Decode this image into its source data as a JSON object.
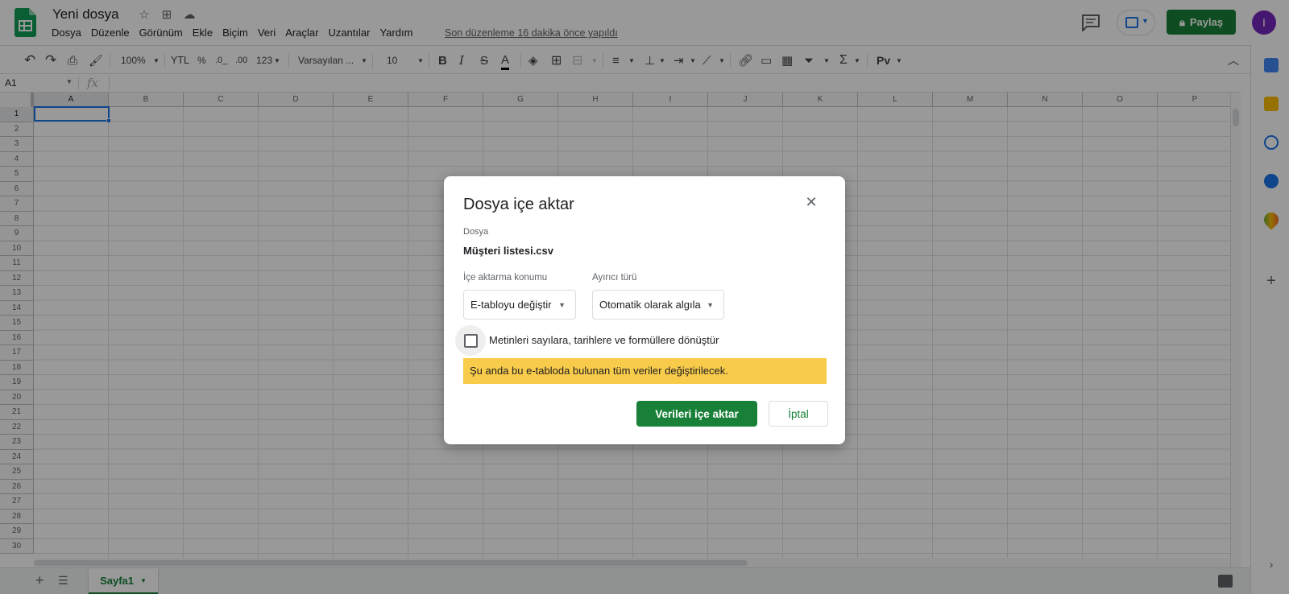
{
  "app": {
    "doc_title": "Yeni dosya",
    "menu": [
      "Dosya",
      "Düzenle",
      "Görünüm",
      "Ekle",
      "Biçim",
      "Veri",
      "Araçlar",
      "Uzantılar",
      "Yardım"
    ],
    "last_edit": "Son düzenleme 16 dakika önce yapıldı",
    "share_label": "Paylaş",
    "avatar_initial": "I"
  },
  "toolbar": {
    "zoom": "100%",
    "currency": "YTL",
    "percent": "%",
    "dec_decrease": ".0_",
    "dec_increase": ".00",
    "number_format": "123",
    "font": "Varsayılan ...",
    "font_size": "10",
    "bold": "B",
    "italic": "I",
    "strike": "S",
    "text_color": "A",
    "sigma": "Σ"
  },
  "formula_bar": {
    "namebox": "A1",
    "fx": "fx"
  },
  "grid": {
    "columns": [
      "A",
      "B",
      "C",
      "D",
      "E",
      "F",
      "G",
      "H",
      "I",
      "J",
      "K",
      "L",
      "M",
      "N",
      "O",
      "P"
    ],
    "rows": [
      "1",
      "2",
      "3",
      "4",
      "5",
      "6",
      "7",
      "8",
      "9",
      "10",
      "11",
      "12",
      "13",
      "14",
      "15",
      "16",
      "17",
      "18",
      "19",
      "20",
      "21",
      "22",
      "23",
      "24",
      "25",
      "26",
      "27",
      "28",
      "29",
      "30"
    ],
    "selected_cell": "A1"
  },
  "sheetbar": {
    "sheet_name": "Sayfa1"
  },
  "dialog": {
    "title": "Dosya içe aktar",
    "file_label": "Dosya",
    "file_name": "Müşteri listesi.csv",
    "location_label": "İçe aktarma konumu",
    "location_value": "E-tabloyu değiştir",
    "separator_label": "Ayırıcı türü",
    "separator_value": "Otomatik olarak algıla",
    "checkbox_label": "Metinleri sayılara, tarihlere ve formüllere dönüştür",
    "checkbox_checked": false,
    "warning": "Şu anda bu e-tabloda bulunan tüm veriler değiştirilecek.",
    "primary_button": "Verileri içe aktar",
    "cancel_button": "İptal"
  },
  "colors": {
    "brand_green": "#188038",
    "accent_blue": "#1a73e8",
    "warning_yellow": "#f9cb4a",
    "avatar_purple": "#7627bb"
  }
}
